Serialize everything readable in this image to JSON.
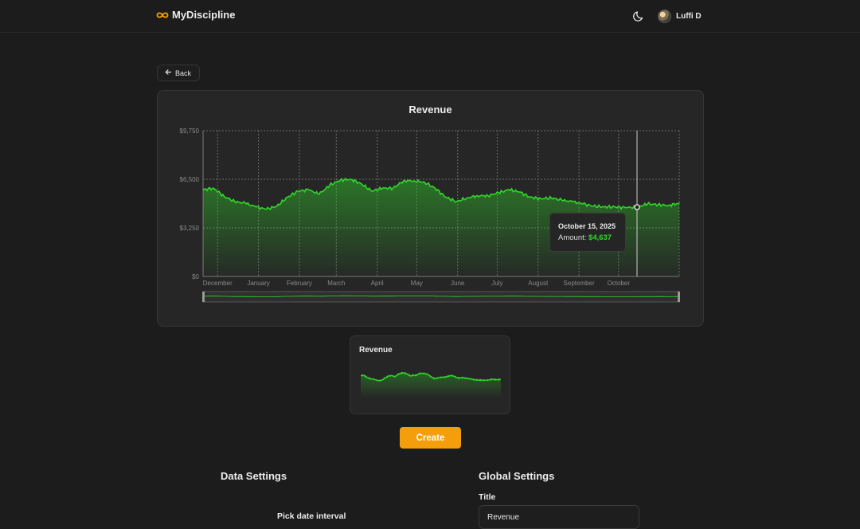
{
  "app": {
    "name": "MyDiscipline"
  },
  "header": {
    "user_name": "Luffi D",
    "theme_icon": "moon-icon",
    "logo_icon": "infinity-icon"
  },
  "back_button": {
    "label": "Back"
  },
  "colors": {
    "accent": "#f59e0b",
    "series": "#31d62a",
    "background": "#1c1c1c",
    "card": "#262626"
  },
  "chart_data": {
    "type": "area",
    "title": "Revenue",
    "xlabel": "",
    "ylabel": "",
    "ylim": [
      0,
      9750
    ],
    "y_ticks": [
      "$0",
      "$3,250",
      "$6,500",
      "$9,750"
    ],
    "x_ticks": [
      "December",
      "January",
      "February",
      "March",
      "April",
      "May",
      "June",
      "July",
      "August",
      "September",
      "October"
    ],
    "grid": true,
    "series": [
      {
        "points": [
          [
            "2024-11-20",
            5800
          ],
          [
            "2024-11-28",
            5900
          ],
          [
            "2024-12-06",
            5350
          ],
          [
            "2024-12-14",
            5000
          ],
          [
            "2024-12-22",
            4900
          ],
          [
            "2024-12-30",
            4650
          ],
          [
            "2025-01-07",
            4500
          ],
          [
            "2025-01-15",
            4700
          ],
          [
            "2025-01-23",
            5300
          ],
          [
            "2025-01-31",
            5700
          ],
          [
            "2025-02-08",
            5800
          ],
          [
            "2025-02-16",
            5500
          ],
          [
            "2025-02-24",
            6100
          ],
          [
            "2025-03-04",
            6450
          ],
          [
            "2025-03-12",
            6500
          ],
          [
            "2025-03-20",
            6200
          ],
          [
            "2025-03-28",
            5700
          ],
          [
            "2025-04-05",
            5900
          ],
          [
            "2025-04-13",
            5900
          ],
          [
            "2025-04-21",
            6400
          ],
          [
            "2025-04-29",
            6400
          ],
          [
            "2025-05-07",
            6300
          ],
          [
            "2025-05-15",
            5900
          ],
          [
            "2025-05-23",
            5300
          ],
          [
            "2025-05-31",
            5000
          ],
          [
            "2025-06-08",
            5250
          ],
          [
            "2025-06-16",
            5400
          ],
          [
            "2025-06-24",
            5400
          ],
          [
            "2025-07-02",
            5600
          ],
          [
            "2025-07-10",
            5800
          ],
          [
            "2025-07-18",
            5650
          ],
          [
            "2025-07-26",
            5300
          ],
          [
            "2025-08-03",
            5200
          ],
          [
            "2025-08-11",
            5250
          ],
          [
            "2025-08-19",
            5100
          ],
          [
            "2025-08-27",
            5000
          ],
          [
            "2025-09-04",
            4850
          ],
          [
            "2025-09-12",
            4700
          ],
          [
            "2025-09-20",
            4650
          ],
          [
            "2025-09-28",
            4650
          ],
          [
            "2025-10-06",
            4600
          ],
          [
            "2025-10-15",
            4637
          ],
          [
            "2025-10-23",
            4850
          ],
          [
            "2025-10-31",
            4800
          ],
          [
            "2025-11-08",
            4750
          ],
          [
            "2025-11-16",
            4900
          ]
        ]
      }
    ],
    "tooltip": {
      "date": "October 15, 2025",
      "amount_label": "Amount:",
      "amount": "$4,637"
    }
  },
  "mini_chart": {
    "title": "Revenue"
  },
  "actions": {
    "create_label": "Create"
  },
  "data_settings": {
    "title": "Data Settings",
    "pick_interval_label": "Pick date interval"
  },
  "global_settings": {
    "title": "Global Settings",
    "title_label": "Title",
    "title_value": "Revenue"
  }
}
